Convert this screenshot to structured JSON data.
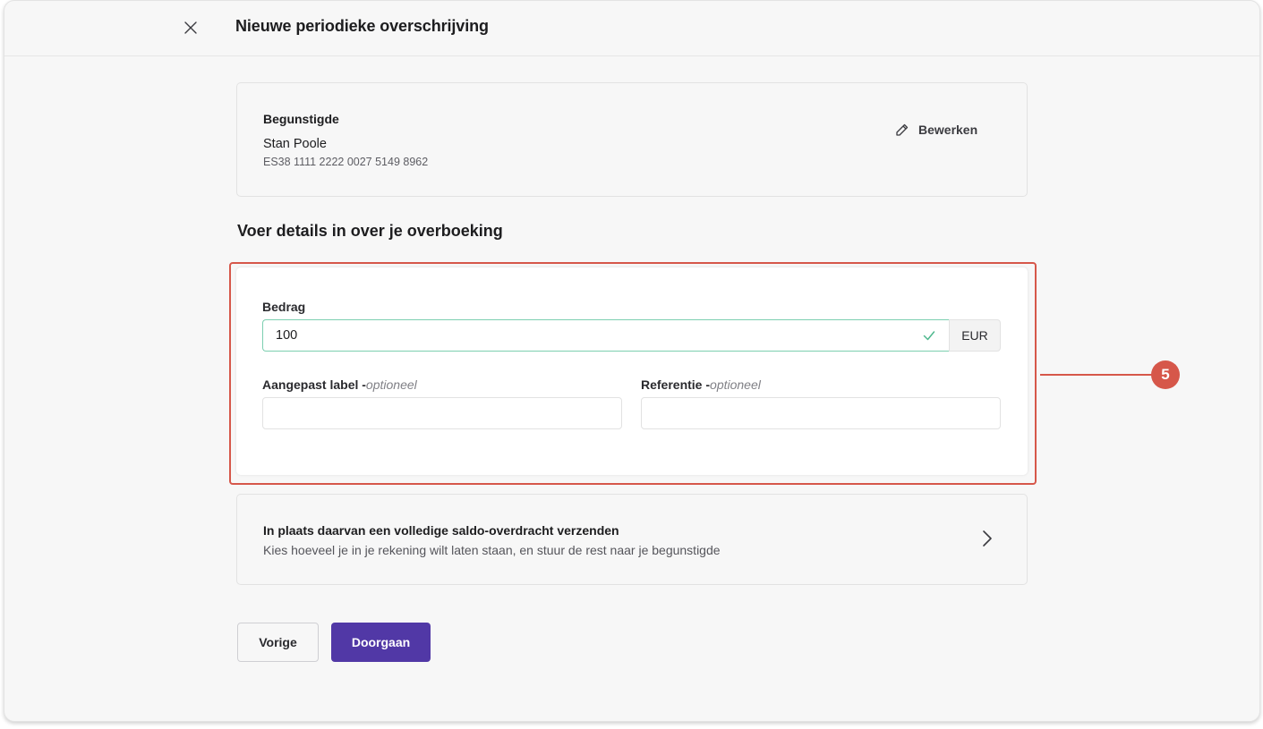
{
  "header": {
    "title": "Nieuwe periodieke overschrijving",
    "close_icon": "close-icon"
  },
  "beneficiary": {
    "heading": "Begunstigde",
    "name": "Stan Poole",
    "iban": "ES38 1111 2222 0027 5149 8962",
    "edit_label": "Bewerken",
    "edit_icon": "pencil-icon"
  },
  "details": {
    "section_title": "Voer details in over je overboeking",
    "amount": {
      "label": "Bedrag",
      "value": "100",
      "currency": "EUR",
      "valid_icon": "check-icon"
    },
    "custom_label": {
      "label": "Aangepast label -",
      "optional": "optioneel",
      "value": ""
    },
    "reference": {
      "label": "Referentie -",
      "optional": "optioneel",
      "value": ""
    }
  },
  "callout": {
    "number": "5",
    "color": "#d6574a"
  },
  "balance_transfer": {
    "title": "In plaats daarvan een volledige saldo-overdracht verzenden",
    "subtitle": "Kies hoeveel je in je rekening wilt laten staan, en stuur de rest naar je begunstigde",
    "chevron_icon": "chevron-right-icon"
  },
  "footer": {
    "back_label": "Vorige",
    "continue_label": "Doorgaan",
    "primary_color": "#5138a6"
  }
}
